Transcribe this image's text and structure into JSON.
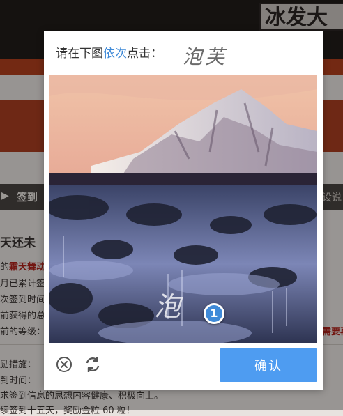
{
  "background_page": {
    "logo_text": "冰发大",
    "nav": {
      "label": "签到",
      "right_text": "设说"
    },
    "heading": "天还未",
    "lines": [
      {
        "prefix": "的",
        "highlight": "霜天舞动"
      },
      {
        "text": "月已累计签"
      },
      {
        "text": "次签到时间"
      },
      {
        "text": "前获得的总"
      },
      {
        "text": "前的等级："
      },
      {
        "text": "励措施："
      },
      {
        "text": "到时间："
      },
      {
        "text": "求签到信息的思想内容健康、积极向上。"
      },
      {
        "text": "续签到十五天，奖励金粒 60 粒！"
      }
    ],
    "right_red": "需要再"
  },
  "captcha": {
    "instruction_prefix": "请在下图",
    "instruction_highlight": "依次",
    "instruction_suffix": "点击：",
    "target_chars": "泡芙",
    "image_char_hint": "泡",
    "marker_number": "1",
    "confirm_label": "确认",
    "accent_color": "#4e9cf1"
  }
}
